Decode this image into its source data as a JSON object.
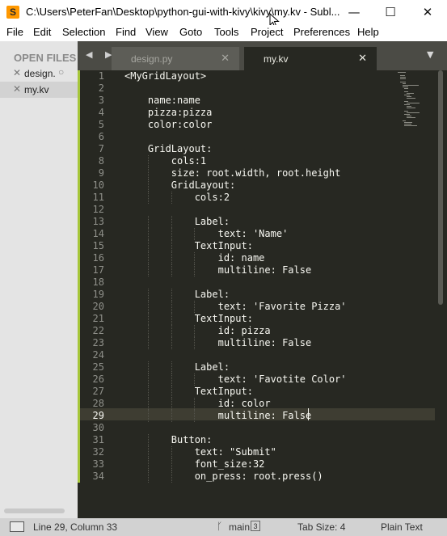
{
  "window": {
    "app_icon_letter": "S",
    "title": "C:\\Users\\PeterFan\\Desktop\\python-gui-with-kivy\\kivy\\my.kv - Subl...",
    "minimize_glyph": "—",
    "maximize_glyph": "☐",
    "close_glyph": "✕"
  },
  "menu": [
    "File",
    "Edit",
    "Selection",
    "Find",
    "View",
    "Goto",
    "Tools",
    "Project",
    "Preferences",
    "Help"
  ],
  "sidebar": {
    "header": "OPEN FILES",
    "files": [
      {
        "name": "design.py",
        "display": "design.",
        "close": "✕",
        "dirty_marker": "○"
      },
      {
        "name": "my.kv",
        "display": "my.kv",
        "close": "✕"
      }
    ]
  },
  "tabs": {
    "nav": "◀ ▶",
    "items": [
      {
        "label": "design.py",
        "close": "✕",
        "active": false
      },
      {
        "label": "my.kv",
        "close": "✕",
        "active": true
      }
    ],
    "dropdown": "▼"
  },
  "editor": {
    "active_line": 29,
    "lines": [
      "<MyGridLayout>",
      "",
      "    name:name",
      "    pizza:pizza",
      "    color:color",
      "",
      "    GridLayout:",
      "        cols:1",
      "        size: root.width, root.height",
      "        GridLayout:",
      "            cols:2",
      "",
      "            Label:",
      "                text: 'Name'",
      "            TextInput:",
      "                id: name",
      "                multiline: False",
      "",
      "            Label:",
      "                text: 'Favorite Pizza'",
      "            TextInput:",
      "                id: pizza",
      "                multiline: False",
      "",
      "            Label:",
      "                text: 'Favotite Color'",
      "            TextInput:",
      "                id: color",
      "                multiline: False",
      "",
      "        Button:",
      "            text: \"Submit\"",
      "            font_size:32",
      "            on_press: root.press()"
    ]
  },
  "status": {
    "position": "Line 29, Column 33",
    "branch": "main",
    "branch_count": "3",
    "tab_size": "Tab Size: 4",
    "syntax": "Plain Text"
  },
  "colors": {
    "editor_bg": "#272822",
    "tabbar_bg": "#4b4b45",
    "sidebar_bg": "#e4e4e4",
    "modified_bar": "#a6c63a",
    "app_icon": "#ff9800"
  }
}
